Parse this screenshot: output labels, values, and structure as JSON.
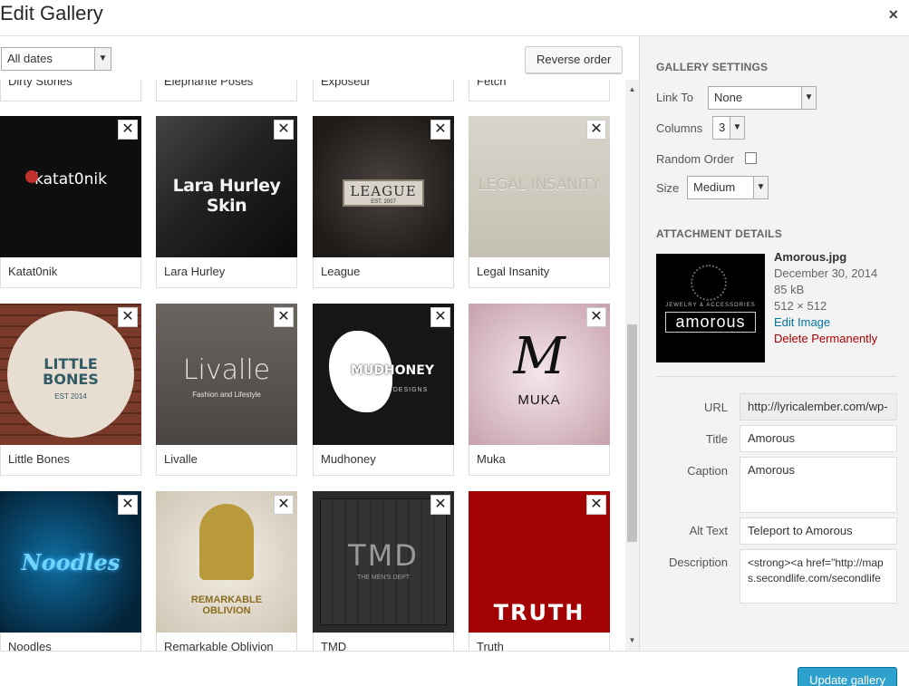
{
  "header": {
    "title": "Edit Gallery",
    "close_glyph": "×"
  },
  "toolbar": {
    "date_filter": "All dates",
    "reverse_label": "Reverse order"
  },
  "grid": {
    "top_row": [
      "Dirty Stories",
      "Elephante Poses",
      "Exposeur",
      "Fetch"
    ],
    "items": [
      {
        "caption": "Katat0nik",
        "logo": "katat0nik"
      },
      {
        "caption": "Lara Hurley",
        "logo": "Lara Hurley Skin"
      },
      {
        "caption": "League",
        "logo": "LEAGUE",
        "sub": "EST. 2007"
      },
      {
        "caption": "Legal Insanity",
        "logo": "LEGAL INSANITY"
      },
      {
        "caption": "Little Bones",
        "logo": "LITTLE BONES",
        "sub": "EST 2014"
      },
      {
        "caption": "Livalle",
        "logo": "Livalle",
        "sub": "Fashion and Lifestyle"
      },
      {
        "caption": "Mudhoney",
        "logo": "MUDHONEY",
        "sub": "DESIGNS"
      },
      {
        "caption": "Muka",
        "logo": "MUKA"
      },
      {
        "caption": "Noodles",
        "logo": "Noodles"
      },
      {
        "caption": "Remarkable Oblivion",
        "logo": "REMARKABLE OBLIVION"
      },
      {
        "caption": "TMD",
        "logo": "TMD",
        "sub": "THE MEN'S DEPT"
      },
      {
        "caption": "Truth",
        "logo": "TRUTH"
      }
    ],
    "remove_glyph": "✕"
  },
  "sidebar": {
    "gallery_heading": "GALLERY SETTINGS",
    "link_to_label": "Link To",
    "link_to_value": "None",
    "columns_label": "Columns",
    "columns_value": "3",
    "random_label": "Random Order",
    "size_label": "Size",
    "size_value": "Medium",
    "attachment_heading": "ATTACHMENT DETAILS",
    "file_name": "Amorous.jpg",
    "date": "December 30, 2014",
    "file_size": "85 kB",
    "dimensions": "512 × 512",
    "edit_link": "Edit Image",
    "delete_link": "Delete Permanently",
    "thumb_logo": "amorous",
    "thumb_tagline": "JEWELRY & ACCESSORIES",
    "url_label": "URL",
    "url_value": "http://lyricalember.com/wp-",
    "title_label": "Title",
    "title_value": "Amorous",
    "caption_label": "Caption",
    "caption_value": "Amorous",
    "alt_label": "Alt Text",
    "alt_value": "Teleport to Amorous",
    "description_label": "Description",
    "description_value": "<strong><a href=\"http://maps.secondlife.com/secondlife"
  },
  "footer": {
    "update_label": "Update gallery"
  },
  "colors": {
    "accent": "#2ea2cc",
    "danger": "#a00",
    "link": "#0074a2"
  }
}
